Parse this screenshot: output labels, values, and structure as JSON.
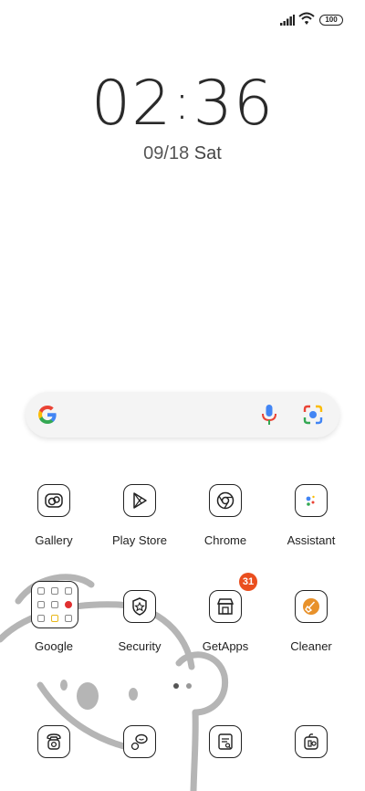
{
  "status_bar": {
    "battery": "100",
    "signal_icon": "signal-icon",
    "wifi_icon": "wifi-icon"
  },
  "clock": {
    "hours": "02",
    "separator": ":",
    "minutes": "36"
  },
  "date": {
    "date": "09/18",
    "day": "Sat"
  },
  "search": {
    "logo_icon": "google-g-icon",
    "mic_icon": "microphone-icon",
    "lens_icon": "google-lens-icon"
  },
  "apps": {
    "row1": [
      {
        "label": "Gallery",
        "icon": "gallery-icon"
      },
      {
        "label": "Play Store",
        "icon": "play-store-icon"
      },
      {
        "label": "Chrome",
        "icon": "chrome-icon"
      },
      {
        "label": "Assistant",
        "icon": "assistant-icon"
      }
    ],
    "row2": [
      {
        "label": "Google",
        "icon": "google-folder-icon"
      },
      {
        "label": "Security",
        "icon": "security-icon"
      },
      {
        "label": "GetApps",
        "icon": "getapps-icon",
        "badge": "31"
      },
      {
        "label": "Cleaner",
        "icon": "cleaner-icon"
      }
    ],
    "dock": [
      {
        "icon": "phone-icon"
      },
      {
        "icon": "messages-icon"
      },
      {
        "icon": "notes-icon"
      },
      {
        "icon": "camera-icon"
      }
    ]
  },
  "colors": {
    "badge": "#ea4e1e",
    "cleaner_accent": "#e8912a",
    "text": "#222222"
  },
  "page_indicator": {
    "pages": 2,
    "current": 1
  }
}
